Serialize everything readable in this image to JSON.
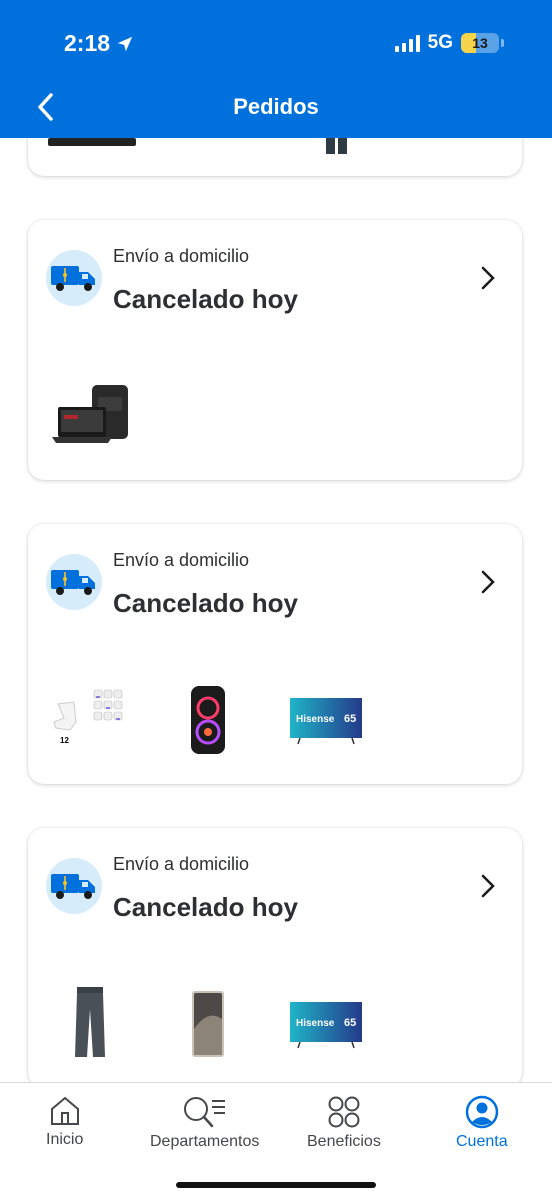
{
  "status_bar": {
    "time": "2:18",
    "network": "5G",
    "battery": "13"
  },
  "header": {
    "title": "Pedidos"
  },
  "orders": [
    {
      "ship_type": "Envío a domicilio",
      "status": "Cancelado hoy",
      "items": [
        "laptop-and-backpack"
      ]
    },
    {
      "ship_type": "Envío a domicilio",
      "status": "Cancelado hoy",
      "items": [
        "socks-pack",
        "party-speaker",
        "hisense-tv"
      ]
    },
    {
      "ship_type": "Envío a domicilio",
      "status": "Cancelado hoy",
      "items": [
        "jogger-pants",
        "smartphone",
        "hisense-tv"
      ]
    }
  ],
  "tv_brand": "Hisense",
  "tv_size": "65",
  "socks_count": "12",
  "bottom_nav": [
    {
      "label": "Inicio",
      "icon": "home-icon"
    },
    {
      "label": "Departamentos",
      "icon": "search-list-icon"
    },
    {
      "label": "Beneficios",
      "icon": "circles-grid-icon"
    },
    {
      "label": "Cuenta",
      "icon": "account-icon",
      "active": true
    }
  ],
  "colors": {
    "brand_blue": "#0071dc",
    "badge_bg": "#d7ecfb",
    "spark_yellow": "#ffc220"
  }
}
